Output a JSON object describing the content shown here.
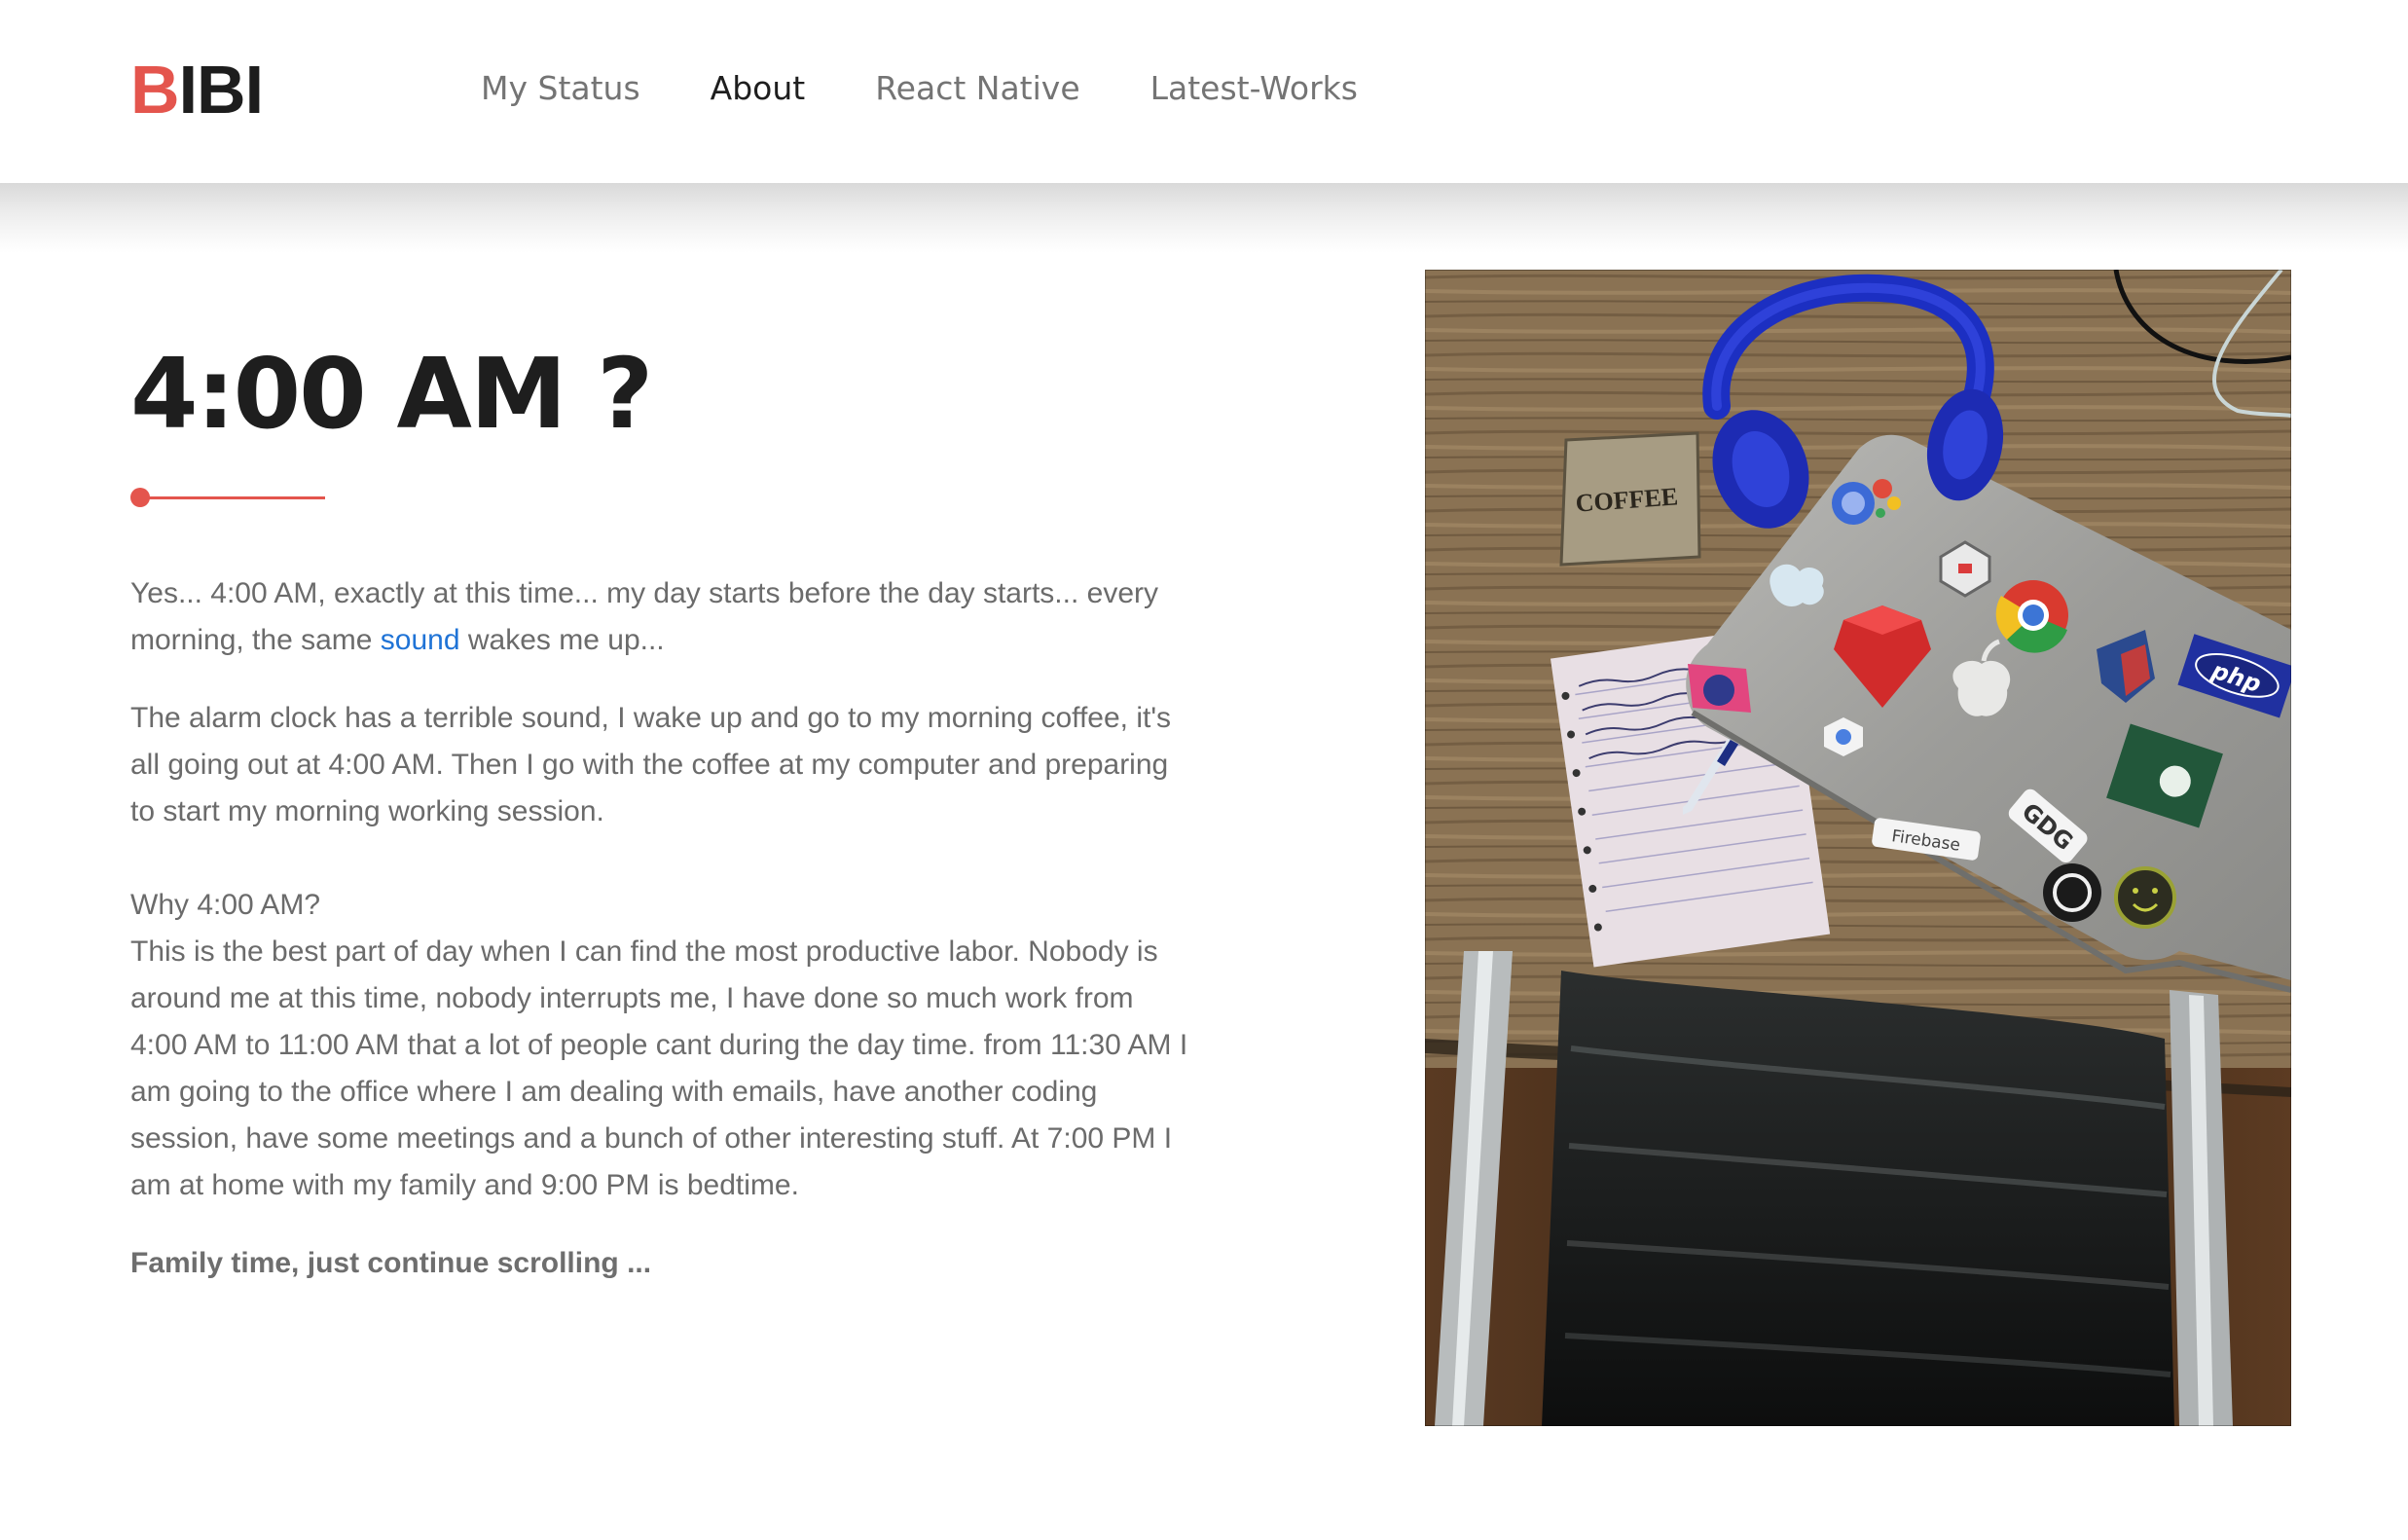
{
  "header": {
    "logo": {
      "accent": "B",
      "rest": "IBI"
    },
    "nav": [
      {
        "label": "My Status",
        "active": false
      },
      {
        "label": "About",
        "active": true
      },
      {
        "label": "React Native",
        "active": false
      },
      {
        "label": "Latest-Works",
        "active": false
      }
    ]
  },
  "main": {
    "title": "4:00 AM ?",
    "paragraph1": {
      "before_link": "Yes... 4:00 AM, exactly at this time... my day starts before the day starts... every morning, the same ",
      "link": "sound",
      "after_link": " wakes me up..."
    },
    "paragraph2": "The alarm clock has a terrible sound, I wake up and go to my morning coffee, it's all going out at 4:00 AM. Then I go with the coffee at my computer and preparing to start my morning working session.",
    "paragraph3": {
      "heading": "Why 4:00 AM?",
      "body": "This is the best part of day when I can find the most productive labor. Nobody is around me at this time, nobody interrupts me, I have done so much work from 4:00 AM to 11:00 AM that a lot of people cant during the day time. from 11:30 AM I am going to the office where I am dealing with emails, have another coding session, have some meetings and a bunch of other interesting stuff. At 7:00 PM I am at home with my family and 9:00 PM is bedtime."
    },
    "closing": "Family time, just continue scrolling ..."
  },
  "photo": {
    "coaster_text": "COFFEE",
    "stickers": [
      "GDG",
      "Firebase",
      "php"
    ]
  },
  "colors": {
    "accent": "#e4554d",
    "link": "#1f73d6",
    "title": "#1e1e1e",
    "body_text": "#6b6b6b",
    "nav_text": "#747474"
  }
}
